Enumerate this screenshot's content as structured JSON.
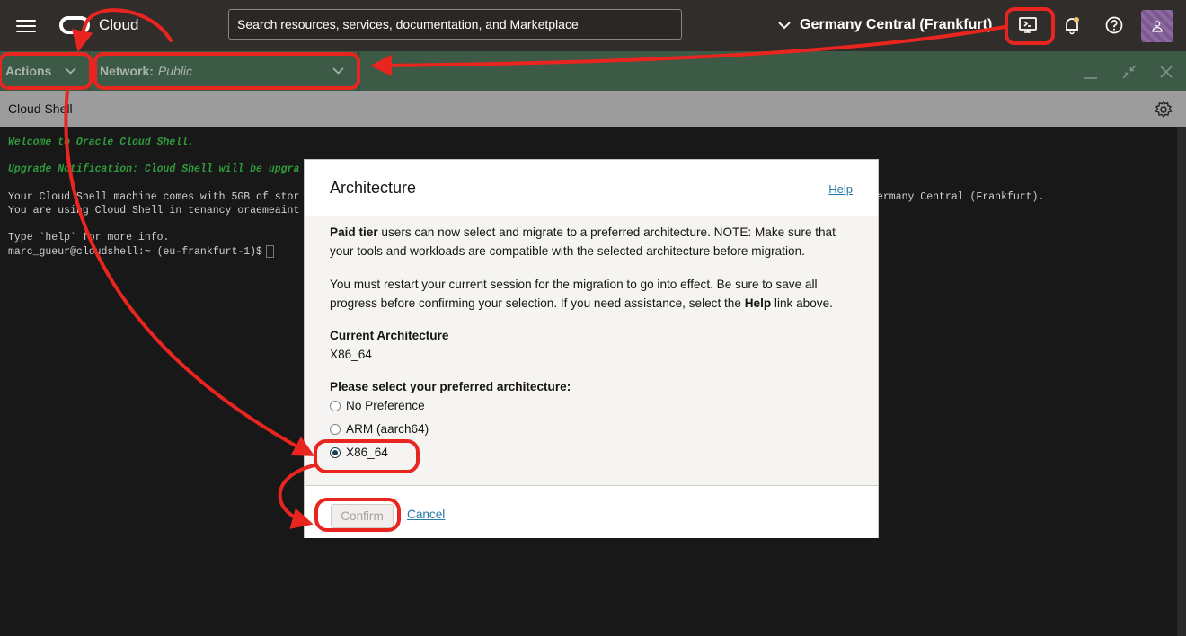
{
  "topbar": {
    "logo_text": "Cloud",
    "search_placeholder": "Search resources, services, documentation, and Marketplace",
    "region": "Germany Central (Frankfurt)"
  },
  "shellbar": {
    "actions_label": "Actions",
    "network_label": "Network:",
    "network_value": "Public"
  },
  "shell": {
    "title": "Cloud Shell"
  },
  "terminal": {
    "lines": [
      "Welcome to Oracle Cloud Shell.",
      "Upgrade Notification: Cloud Shell will be upgra",
      "Your Cloud Shell machine comes with 5GB of stor",
      "You are using Cloud Shell in tenancy oraemeaint",
      "Type `help` for more info.",
      "marc_gueur@cloudshell:~ (eu-frankfurt-1)$"
    ],
    "right_fragment": "ermany Central (Frankfurt)."
  },
  "modal": {
    "title": "Architecture",
    "help_link": "Help",
    "para1_bold": "Paid tier",
    "para1_line1": " users can now select and migrate to a preferred architecture. NOTE: Make sure that",
    "para1_line2": "your tools and workloads are compatible with the selected architecture before migration.",
    "para2_line1": "You must restart your current session for the migration to go into effect. Be sure to save all",
    "para2_line2_a": "progress before confirming your selection. If you need assistance, select the ",
    "para2_line2_bold": "Help",
    "para2_line2_b": " link above.",
    "current_label": "Current Architecture",
    "current_value": "X86_64",
    "select_label": "Please select your preferred architecture:",
    "options": [
      "No Preference",
      "ARM (aarch64)",
      "X86_64"
    ],
    "selected": "X86_64",
    "confirm": "Confirm",
    "cancel": "Cancel"
  },
  "colors": {
    "annotation": "#e8251f",
    "topbar": "#312d2a",
    "shellbar": "#3c5a45",
    "link": "#2a7aa8"
  }
}
